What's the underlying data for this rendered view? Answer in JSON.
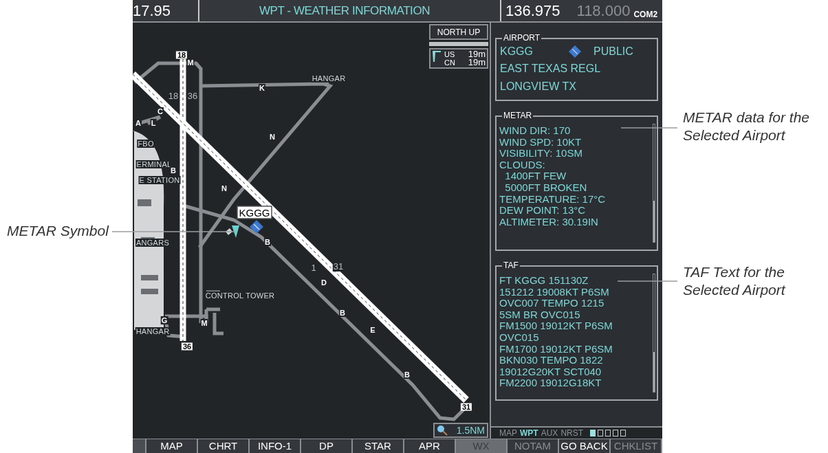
{
  "top_bar": {
    "nav_frequency": "17.95",
    "title": "WPT - WEATHER INFORMATION",
    "com_active": "136.975",
    "com_standby": "118.000",
    "com_label": "COM2"
  },
  "map": {
    "orientation": "NORTH UP",
    "wind_legend": [
      {
        "label": "US",
        "value": "19m"
      },
      {
        "label": "CN",
        "value": "19m"
      }
    ],
    "labels": [
      {
        "text": "18",
        "kind": "runway_end"
      },
      {
        "text": "M",
        "kind": "taxiway"
      },
      {
        "text": "HANGAR",
        "kind": "place"
      },
      {
        "text": "K",
        "kind": "taxiway"
      },
      {
        "text": "18",
        "kind": "runway"
      },
      {
        "text": "36",
        "kind": "runway"
      },
      {
        "text": "C",
        "kind": "taxiway"
      },
      {
        "text": "A",
        "kind": "taxiway"
      },
      {
        "text": "L",
        "kind": "taxiway"
      },
      {
        "text": "FBO",
        "kind": "place"
      },
      {
        "text": "ERMINAL",
        "kind": "place"
      },
      {
        "text": "B",
        "kind": "taxiway"
      },
      {
        "text": "E STATION",
        "kind": "place"
      },
      {
        "text": "N",
        "kind": "taxiway"
      },
      {
        "text": "N",
        "kind": "taxiway"
      },
      {
        "text": "KGGG",
        "kind": "airport_id"
      },
      {
        "text": "ANGARS",
        "kind": "place"
      },
      {
        "text": "B",
        "kind": "taxiway"
      },
      {
        "text": "1",
        "kind": "runway"
      },
      {
        "text": "31",
        "kind": "runway"
      },
      {
        "text": "D",
        "kind": "taxiway"
      },
      {
        "text": "CONTROL TOWER",
        "kind": "place"
      },
      {
        "text": "B",
        "kind": "taxiway"
      },
      {
        "text": "E",
        "kind": "taxiway"
      },
      {
        "text": "G",
        "kind": "taxiway"
      },
      {
        "text": "M",
        "kind": "taxiway"
      },
      {
        "text": "HANGAR",
        "kind": "place"
      },
      {
        "text": "36",
        "kind": "runway_end"
      },
      {
        "text": "B",
        "kind": "taxiway"
      },
      {
        "text": "31",
        "kind": "runway_end"
      }
    ],
    "range": "1.5NM"
  },
  "airport": {
    "title": "AIRPORT",
    "identifier": "KGGG",
    "type": "PUBLIC",
    "name": "EAST TEXAS REGL",
    "city": "LONGVIEW TX"
  },
  "metar": {
    "title": "METAR",
    "lines": [
      "WIND DIR: 170",
      "WIND SPD: 10KT",
      "VISIBILITY: 10SM",
      "CLOUDS:",
      "  1400FT FEW",
      "  5000FT BROKEN",
      "TEMPERATURE: 17°C",
      "DEW POINT: 13°C",
      "ALTIMETER: 30.19IN"
    ]
  },
  "taf": {
    "title": "TAF",
    "lines": [
      "FT KGGG 151130Z",
      "151212 19008KT P6SM",
      "OVC007 TEMPO 1215",
      "5SM BR OVC015",
      "FM1500 19012KT P6SM",
      "OVC015",
      "FM1700 19012KT P6SM",
      "BKN030 TEMPO 1822",
      "19012G20KT SCT040",
      "FM2200 19012G18KT"
    ]
  },
  "page_groups": {
    "items": [
      {
        "label": "MAP",
        "selected": false
      },
      {
        "label": "WPT",
        "selected": true
      },
      {
        "label": "AUX",
        "selected": false
      },
      {
        "label": "NRST",
        "selected": false
      }
    ],
    "pages": [
      {
        "selected": true
      },
      {
        "selected": false
      },
      {
        "selected": false
      },
      {
        "selected": false
      },
      {
        "selected": false
      }
    ]
  },
  "softkeys": [
    {
      "label": "MAP",
      "selected": false,
      "disabled": false
    },
    {
      "label": "CHRT",
      "selected": false,
      "disabled": false
    },
    {
      "label": "INFO-1",
      "selected": false,
      "disabled": false
    },
    {
      "label": "DP",
      "selected": false,
      "disabled": false
    },
    {
      "label": "STAR",
      "selected": false,
      "disabled": false
    },
    {
      "label": "APR",
      "selected": false,
      "disabled": false
    },
    {
      "label": "WX",
      "selected": true,
      "disabled": false
    },
    {
      "label": "NOTAM",
      "selected": false,
      "disabled": true
    },
    {
      "label": "GO BACK",
      "selected": false,
      "disabled": false
    },
    {
      "label": "CHKLIST",
      "selected": false,
      "disabled": true
    }
  ],
  "callouts": [
    {
      "lines": [
        "METAR Symbol"
      ]
    },
    {
      "lines": [
        "METAR data for the",
        "Selected Airport"
      ]
    },
    {
      "lines": [
        "TAF Text for the",
        "Selected Airport"
      ]
    }
  ]
}
